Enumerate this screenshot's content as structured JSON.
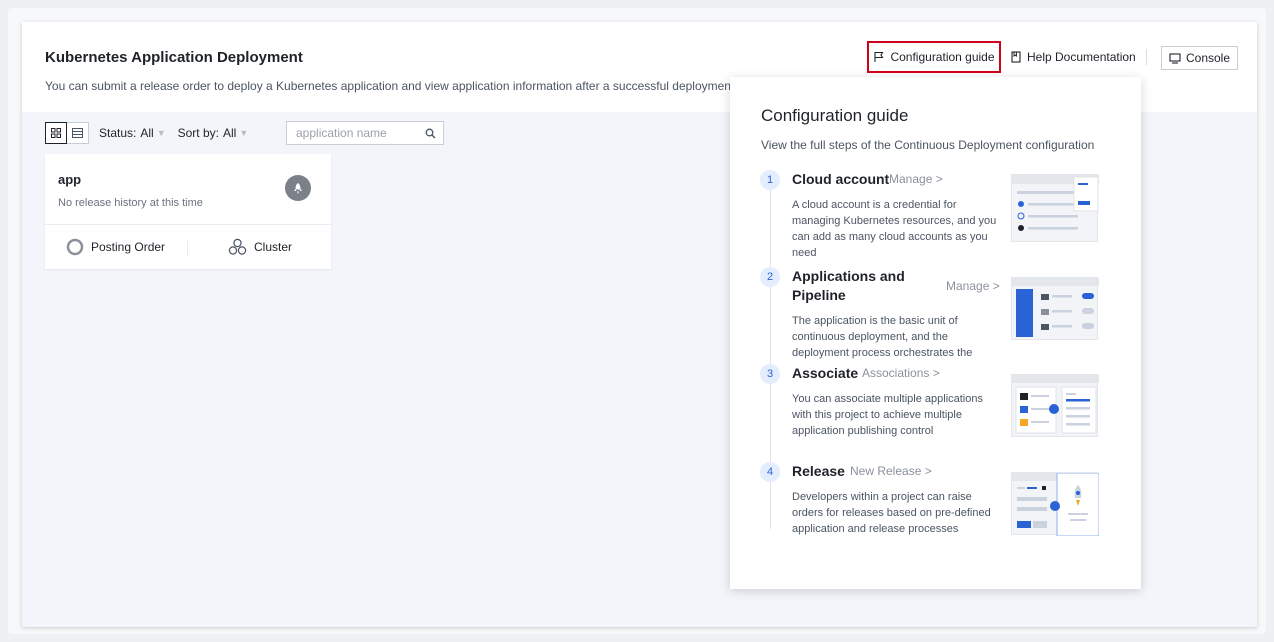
{
  "header": {
    "title": "Kubernetes Application Deployment",
    "subtitle": "You can submit a release order to deploy a Kubernetes application and view application information after a successful deployment.",
    "config_guide_label": "Configuration guide",
    "help_label": "Help Documentation",
    "console_label": "Console"
  },
  "toolbar": {
    "status_label": "Status:",
    "status_value": "All",
    "sort_label": "Sort by:",
    "sort_value": "All",
    "search_placeholder": "application name"
  },
  "app_card": {
    "name": "app",
    "history": "No release history at this time",
    "action_order": "Posting Order",
    "action_cluster": "Cluster"
  },
  "guide": {
    "title": "Configuration guide",
    "subtitle": "View the full steps of the Continuous Deployment configuration",
    "steps": [
      {
        "num": "1",
        "title": "Cloud account",
        "link": "Manage >",
        "desc": "A cloud account is a credential for managing Kubernetes resources, and you can add as many cloud accounts as you need"
      },
      {
        "num": "2",
        "title_line1": "Applications and",
        "title_line2": "Pipeline",
        "link": "Manage >",
        "desc": "The application is the basic unit of continuous deployment, and the deployment process orchestrates the"
      },
      {
        "num": "3",
        "title": "Associate",
        "link": "Associations >",
        "desc": "You can associate multiple applications with this project to achieve multiple application publishing control"
      },
      {
        "num": "4",
        "title": "Release",
        "link": "New Release >",
        "desc": "Developers within a project can raise orders for releases based on pre-defined application and release processes"
      }
    ]
  },
  "colors": {
    "accent": "#2a63d6",
    "highlight_border": "#d0021b",
    "panel_bg": "#f2f5f9"
  }
}
